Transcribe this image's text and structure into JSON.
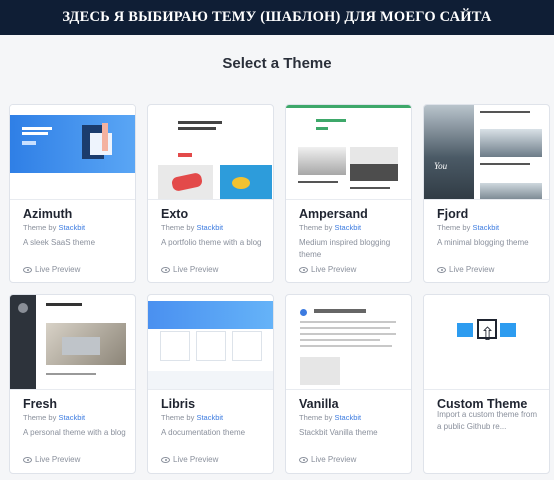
{
  "banner": {
    "text": "ЗДЕСЬ Я ВЫБИРАЮ ТЕМУ (ШАБЛОН) ДЛЯ МОЕГО САЙТА"
  },
  "heading": "Select a Theme",
  "by_prefix": "Theme by",
  "cards": [
    {
      "name": "Azimuth",
      "author": "Stackbit",
      "desc": "A sleek SaaS theme",
      "preview": "Live Preview"
    },
    {
      "name": "Exto",
      "author": "Stackbit",
      "desc": "A portfolio theme with a blog",
      "preview": "Live Preview"
    },
    {
      "name": "Ampersand",
      "author": "Stackbit",
      "desc": "Medium inspired blogging theme",
      "preview": "Live Preview"
    },
    {
      "name": "Fjord",
      "author": "Stackbit",
      "desc": "A minimal blogging theme",
      "preview": "Live Preview"
    },
    {
      "name": "Fresh",
      "author": "Stackbit",
      "desc": "A personal theme with a blog",
      "preview": "Live Preview"
    },
    {
      "name": "Libris",
      "author": "Stackbit",
      "desc": "A documentation theme",
      "preview": "Live Preview"
    },
    {
      "name": "Vanilla",
      "author": "Stackbit",
      "desc": "Stackbit Vanilla theme",
      "preview": "Live Preview"
    },
    {
      "name": "Custom Theme",
      "desc": "Import a custom theme from a public Github re..."
    }
  ],
  "thumb_text": {
    "fjord_script": "You",
    "exto_title": "Hi, I'm Stackbit Exto Portfolio Theme.",
    "fresh_title": "Hi, I'm Fresh."
  },
  "colors": {
    "banner_bg": "#0f1e35",
    "link": "#3c7be0",
    "accent_blue": "#2d9cf0"
  }
}
